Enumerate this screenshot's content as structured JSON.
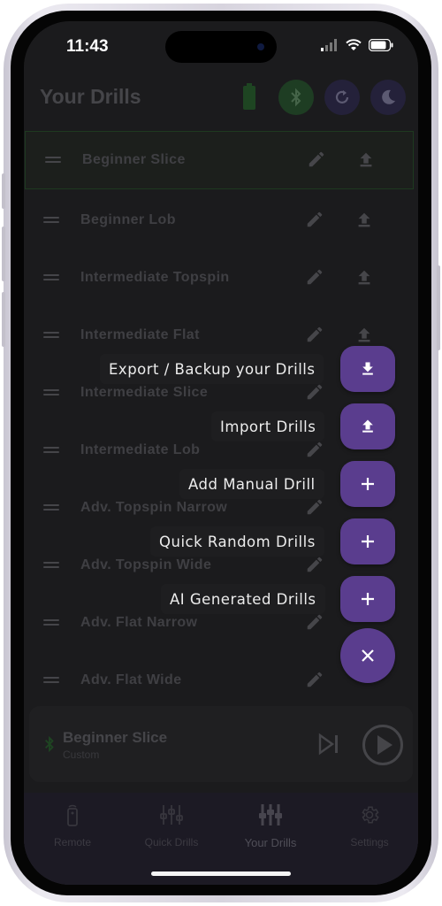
{
  "status_bar": {
    "time": "11:43"
  },
  "header": {
    "title": "Your Drills"
  },
  "drills": [
    {
      "name": "Beginner Slice",
      "active": true
    },
    {
      "name": "Beginner Lob"
    },
    {
      "name": "Intermediate Topspin"
    },
    {
      "name": "Intermediate Flat"
    },
    {
      "name": "Intermediate Slice"
    },
    {
      "name": "Intermediate Lob"
    },
    {
      "name": "Adv. Topspin Narrow"
    },
    {
      "name": "Adv. Topspin Wide"
    },
    {
      "name": "Adv. Flat Narrow"
    },
    {
      "name": "Adv. Flat Wide"
    }
  ],
  "fab_menu": {
    "export_label": "Export / Backup your Drills",
    "import_label": "Import Drills",
    "manual_label": "Add Manual Drill",
    "random_label": "Quick Random Drills",
    "ai_label": "AI Generated Drills"
  },
  "player": {
    "title": "Beginner Slice",
    "subtitle": "Custom"
  },
  "tab_bar": {
    "remote": "Remote",
    "quick_drills": "Quick Drills",
    "your_drills": "Your Drills",
    "settings": "Settings"
  },
  "colors": {
    "accent_purple": "#5a3d8e",
    "bluetooth_green": "#2e6b3a",
    "battery_green": "#2f6a35",
    "active_border": "#2f5a32"
  }
}
